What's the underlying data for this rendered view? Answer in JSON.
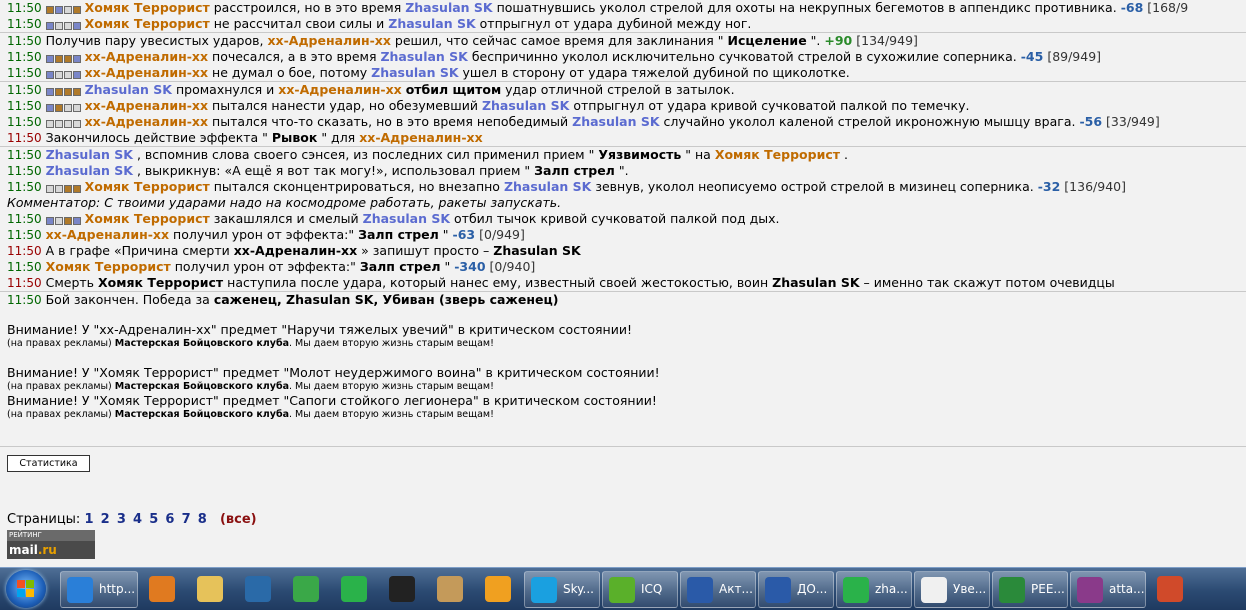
{
  "log": {
    "lines": [
      {
        "t": "11:50",
        "sep": false,
        "blocks": [
          "f",
          "b",
          "g",
          "f"
        ],
        "parts": [
          [
            "you",
            "Хомяк Террорист"
          ],
          [
            "",
            "расстроился, но в это время"
          ],
          [
            "en",
            "Zhasulan SK"
          ],
          [
            "",
            "пошатнувшись уколол стрелой для охоты на некрупных бегемотов в аппендикс противника."
          ],
          [
            "num",
            "-68"
          ],
          [
            "hp",
            "[168/9"
          ]
        ]
      },
      {
        "t": "11:50",
        "sep": false,
        "blocks": [
          "b",
          "g",
          "g",
          "b"
        ],
        "parts": [
          [
            "you",
            "Хомяк Террорист"
          ],
          [
            "",
            "не рассчитал свои силы и"
          ],
          [
            "en",
            "Zhasulan SK"
          ],
          [
            "",
            "отпрыгнул от удара дубиной между ног."
          ]
        ]
      },
      {
        "t": "11:50",
        "sep": true,
        "blocks": [],
        "parts": [
          [
            "",
            "Получив пару увесистых ударов,"
          ],
          [
            "you",
            "xx-Адреналин-xx"
          ],
          [
            "",
            "решил, что сейчас самое время для заклинания \""
          ],
          [
            "b",
            "Исцеление"
          ],
          [
            "",
            "\"."
          ],
          [
            "num g",
            "+90"
          ],
          [
            "hp",
            "[134/949]"
          ]
        ]
      },
      {
        "t": "11:50",
        "sep": false,
        "blocks": [
          "b",
          "f",
          "f",
          "b"
        ],
        "parts": [
          [
            "you",
            "xx-Адреналин-xx"
          ],
          [
            "",
            "почесался, а в это время"
          ],
          [
            "en",
            "Zhasulan SK"
          ],
          [
            "",
            "беспричинно уколол исключительно сучковатой стрелой в сухожилие соперника."
          ],
          [
            "num",
            "-45"
          ],
          [
            "hp",
            "[89/949]"
          ]
        ]
      },
      {
        "t": "11:50",
        "sep": false,
        "blocks": [
          "b",
          "g",
          "g",
          "b"
        ],
        "parts": [
          [
            "you",
            "xx-Адреналин-xx"
          ],
          [
            "",
            "не думал о бое, потому"
          ],
          [
            "en",
            "Zhasulan SK"
          ],
          [
            "",
            "ушел в сторону от удара тяжелой дубиной по щиколотке."
          ]
        ]
      },
      {
        "t": "11:50",
        "sep": true,
        "blocks": [
          "b",
          "f",
          "f",
          "f"
        ],
        "parts": [
          [
            "en",
            "Zhasulan SK"
          ],
          [
            "",
            "промахнулся и"
          ],
          [
            "you",
            "xx-Адреналин-xx"
          ],
          [
            "b",
            "отбил щитом"
          ],
          [
            "",
            "удар отличной стрелой в затылок."
          ]
        ]
      },
      {
        "t": "11:50",
        "sep": false,
        "blocks": [
          "b",
          "f",
          "g",
          "g"
        ],
        "parts": [
          [
            "you",
            "xx-Адреналин-xx"
          ],
          [
            "",
            "пытался нанести удар, но обезумевший"
          ],
          [
            "en",
            "Zhasulan SK"
          ],
          [
            "",
            "отпрыгнул от удара кривой сучковатой палкой по темечку."
          ]
        ]
      },
      {
        "t": "11:50",
        "sep": false,
        "blocks": [
          "g",
          "g",
          "g",
          "g"
        ],
        "parts": [
          [
            "you",
            "xx-Адреналин-xx"
          ],
          [
            "",
            "пытался что-то сказать, но в это время непобедимый"
          ],
          [
            "en",
            "Zhasulan SK"
          ],
          [
            "",
            "случайно уколол каленой стрелой икроножную мышцу врага."
          ],
          [
            "num",
            "-56"
          ],
          [
            "hp",
            "[33/949]"
          ]
        ]
      },
      {
        "t": "11:50",
        "sep": false,
        "red": true,
        "blocks": [],
        "parts": [
          [
            "",
            "Закончилось действие эффекта \""
          ],
          [
            "b",
            "Рывок"
          ],
          [
            "",
            "\" для"
          ],
          [
            "you",
            "xx-Адреналин-xx"
          ]
        ]
      },
      {
        "t": "11:50",
        "sep": true,
        "blocks": [],
        "parts": [
          [
            "en",
            "Zhasulan SK"
          ],
          [
            "",
            ", вспомнив слова своего сэнсея, из последних сил применил прием \""
          ],
          [
            "b",
            "Уязвимость"
          ],
          [
            "",
            "\" на"
          ],
          [
            "you",
            "Хомяк Террорист"
          ],
          [
            "",
            "."
          ]
        ]
      },
      {
        "t": "11:50",
        "sep": false,
        "blocks": [],
        "parts": [
          [
            "en",
            "Zhasulan SK"
          ],
          [
            "",
            ", выкрикнув: «А ещё я вот так могу!», использовал прием \""
          ],
          [
            "b",
            "Залп стрел"
          ],
          [
            "",
            "\"."
          ]
        ]
      },
      {
        "t": "11:50",
        "sep": false,
        "blocks": [
          "g",
          "g",
          "f",
          "f"
        ],
        "parts": [
          [
            "you",
            "Хомяк Террорист"
          ],
          [
            "",
            "пытался сконцентрироваться, но внезапно"
          ],
          [
            "en",
            "Zhasulan SK"
          ],
          [
            "",
            "зевнув, уколол неописуемо острой стрелой в мизинец соперника."
          ],
          [
            "num",
            "-32"
          ],
          [
            "hp",
            "[136/940]"
          ]
        ]
      },
      {
        "t": "",
        "sep": false,
        "blocks": [],
        "parts": [
          [
            "i",
            "Комментатор: С твоими ударами надо на космодроме работать, ракеты запускать."
          ]
        ]
      },
      {
        "t": "11:50",
        "sep": false,
        "blocks": [
          "b",
          "g",
          "f",
          "b"
        ],
        "parts": [
          [
            "you",
            "Хомяк Террорист"
          ],
          [
            "",
            "закашлялся и смелый"
          ],
          [
            "en",
            "Zhasulan SK"
          ],
          [
            "",
            "отбил тычок кривой сучковатой палкой под дых."
          ]
        ]
      },
      {
        "t": "11:50",
        "sep": false,
        "blocks": [],
        "parts": [
          [
            "you",
            "xx-Адреналин-xx"
          ],
          [
            "",
            "получил урон от эффекта:\""
          ],
          [
            "b",
            "Залп стрел"
          ],
          [
            "",
            "\""
          ],
          [
            "num",
            "-63"
          ],
          [
            "hp",
            "[0/949]"
          ]
        ]
      },
      {
        "t": "11:50",
        "sep": false,
        "red": true,
        "blocks": [],
        "parts": [
          [
            "",
            "А в графе «Причина смерти"
          ],
          [
            "b",
            "xx-Адреналин-xx"
          ],
          [
            "",
            "» запишут просто –"
          ],
          [
            "b",
            "Zhasulan SK"
          ]
        ]
      },
      {
        "t": "11:50",
        "sep": false,
        "blocks": [],
        "parts": [
          [
            "you",
            "Хомяк Террорист"
          ],
          [
            "",
            "получил урон от эффекта:\""
          ],
          [
            "b",
            "Залп стрел"
          ],
          [
            "",
            "\""
          ],
          [
            "num",
            "-340"
          ],
          [
            "hp",
            "[0/940]"
          ]
        ]
      },
      {
        "t": "11:50",
        "sep": false,
        "red": true,
        "blocks": [],
        "parts": [
          [
            "",
            "Смерть"
          ],
          [
            "b",
            "Хомяк Террорист"
          ],
          [
            "",
            "наступила после удара, который нанес ему, известный своей жестокостью, воин"
          ],
          [
            "b",
            "Zhasulan SK"
          ],
          [
            "",
            "– именно так скажут потом очевидцы"
          ]
        ]
      },
      {
        "t": "11:50",
        "sep": true,
        "blocks": [],
        "parts": [
          [
            "",
            "Бой закончен. Победа за"
          ],
          [
            "b",
            "саженец, Zhasulan SK, Убиван (зверь саженец)"
          ]
        ]
      }
    ],
    "notices": [
      {
        "text": "Внимание! У \"xx-Адреналин-xx\" предмет \"Наручи тяжелых увечий\" в критическом состоянии!",
        "adv_pre": "(на правах рекламы)",
        "adv_bold": "Мастерская Бойцовского клуба",
        "adv_post": ". Мы даем вторую жизнь старым вещам!"
      },
      {
        "text": "Внимание! У \"Хомяк Террорист\" предмет \"Молот неудержимого воина\" в критическом состоянии!",
        "adv_pre": "(на правах рекламы)",
        "adv_bold": "Мастерская Бойцовского клуба",
        "adv_post": ". Мы даем вторую жизнь старым вещам!"
      },
      {
        "text": "Внимание! У \"Хомяк Террорист\" предмет \"Сапоги стойкого легионера\" в критическом состоянии!",
        "adv_pre": "(на правах рекламы)",
        "adv_bold": "Мастерская Бойцовского клуба",
        "adv_post": ". Мы даем вторую жизнь старым вещам!"
      }
    ]
  },
  "stats_button": "Статистика",
  "pages": {
    "label": "Страницы:",
    "items": [
      "1",
      "2",
      "3",
      "4",
      "5",
      "6",
      "7",
      "8"
    ],
    "all": "(все)"
  },
  "rating": {
    "top": "РЕЙТИНГ",
    "mail": "mail",
    "ru": ".ru"
  },
  "taskbar": {
    "items": [
      {
        "icon": "internet-explorer-icon",
        "label": "http...",
        "color": "#2a7fd8",
        "kind": "app",
        "w": 76
      },
      {
        "icon": "media-player-icon",
        "label": "",
        "color": "#e07a20",
        "kind": "pin"
      },
      {
        "icon": "folder-icon",
        "label": "",
        "color": "#e6c25a",
        "kind": "pin"
      },
      {
        "icon": "kmplayer-icon",
        "label": "",
        "color": "#2a6aa8",
        "kind": "pin"
      },
      {
        "icon": "chrome-icon",
        "label": "",
        "color": "#3aa848",
        "kind": "pin"
      },
      {
        "icon": "mail-agent-icon",
        "label": "",
        "color": "#2ab24a",
        "kind": "pin"
      },
      {
        "icon": "clapperboard-icon",
        "label": "",
        "color": "#222222",
        "kind": "pin"
      },
      {
        "icon": "archive-box-icon",
        "label": "",
        "color": "#c49a5a",
        "kind": "pin"
      },
      {
        "icon": "aimp-icon",
        "label": "",
        "color": "#f0a020",
        "kind": "pin"
      },
      {
        "icon": "skype-icon",
        "label": "Sky...",
        "color": "#1aa0e0",
        "kind": "app",
        "w": 74
      },
      {
        "icon": "icq-icon",
        "label": "ICQ",
        "color": "#5ab02a",
        "kind": "app",
        "w": 74
      },
      {
        "icon": "word-doc-icon",
        "label": "Акт...",
        "color": "#2a5aa8",
        "kind": "app",
        "w": 74
      },
      {
        "icon": "word-doc-icon",
        "label": "ДО...",
        "color": "#2a5aa8",
        "kind": "app",
        "w": 74
      },
      {
        "icon": "mail-agent-icon",
        "label": "zha...",
        "color": "#2ab24a",
        "kind": "app",
        "w": 74
      },
      {
        "icon": "envelope-icon",
        "label": "Уве...",
        "color": "#f0f0f0",
        "kind": "app",
        "w": 74
      },
      {
        "icon": "excel-doc-icon",
        "label": "РЕЕ...",
        "color": "#2a8a3a",
        "kind": "app",
        "w": 74
      },
      {
        "icon": "winrar-icon",
        "label": "atta...",
        "color": "#8a3a8a",
        "kind": "app",
        "w": 74
      },
      {
        "icon": "shelf-icon",
        "label": "",
        "color": "#d04a2a",
        "kind": "pin"
      }
    ]
  },
  "colors": {
    "time": "#006600",
    "time_red": "#990000",
    "you": "#c06b00",
    "enemy": "#5b6bd0",
    "damage": "#2a5fa6",
    "heal": "#2a8a2a"
  }
}
